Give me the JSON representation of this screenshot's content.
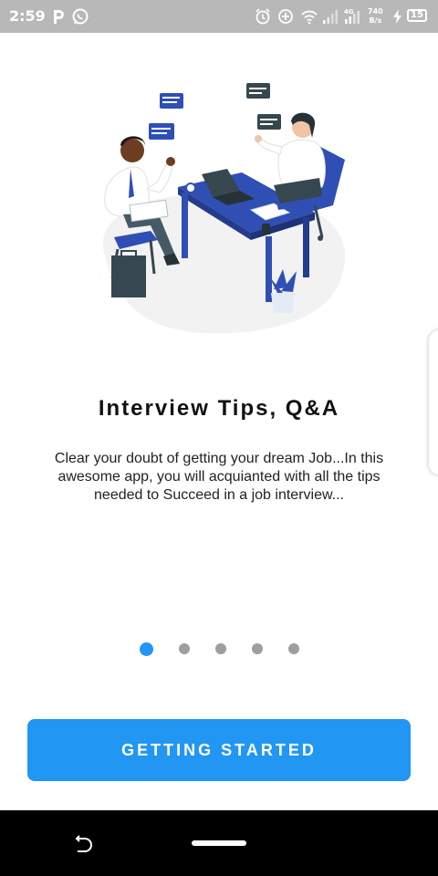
{
  "status_bar": {
    "time": "2:59",
    "speed_value": "740",
    "speed_unit": "B/s",
    "battery": "15",
    "network": "4G",
    "icons": [
      "p-app-icon",
      "whatsapp-icon",
      "alarm-icon",
      "data-saver-icon",
      "wifi-icon",
      "signal-icon",
      "charging-icon",
      "battery-icon"
    ]
  },
  "onboarding": {
    "illustration": "interview-illustration",
    "title": "Interview Tips, Q&A",
    "description": "Clear your doubt of getting your dream Job...In this awesome app, you will acquianted with all the tips needed to Succeed in a job interview...",
    "page_count": 5,
    "active_page": 1
  },
  "cta": {
    "label": "GETTING STARTED"
  },
  "colors": {
    "accent": "#2196f3",
    "dot_inactive": "#9e9e9e",
    "status_bar_bg": "#b8b8b8",
    "nav_bar_bg": "#000000",
    "desk_blue": "#2f4fb5"
  }
}
